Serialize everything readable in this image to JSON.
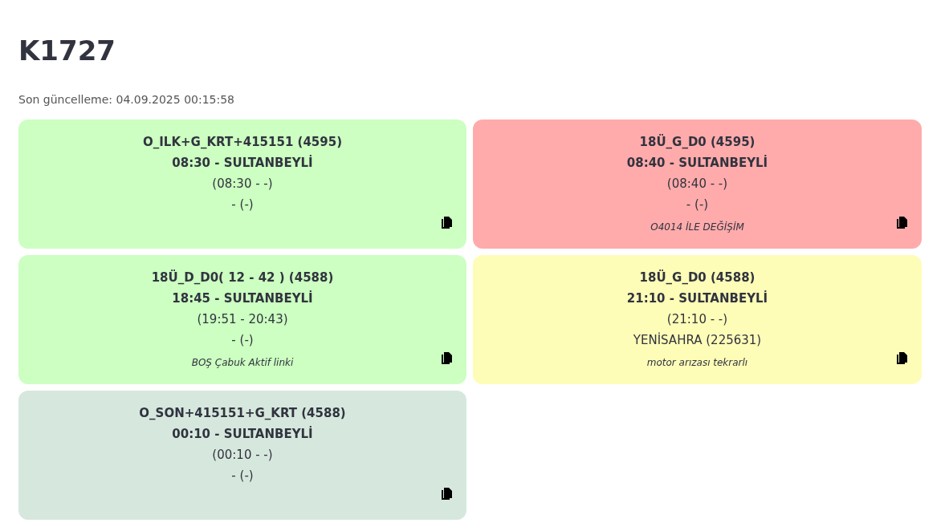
{
  "title": "K1727",
  "last_updated": "Son güncelleme: 04.09.2025 00:15:58",
  "cards": [
    {
      "color": "#ccffc1",
      "route": "O_ILK+G_KRT+415151 (4595)",
      "departure": "08:30 - SULTANBEYLİ",
      "times": "(08:30 - -)",
      "vehicle": "- (-)"
    },
    {
      "color": "#ffabab",
      "route": "18Ü_G_D0 (4595)",
      "departure": "08:40 - SULTANBEYLİ",
      "times": "(08:40 - -)",
      "vehicle": "- (-)",
      "note": "O4014 İLE DEĞİŞİM"
    },
    {
      "color": "#ccffc1",
      "route": "18Ü_D_D0( 12 - 42 ) (4588)",
      "departure": "18:45 - SULTANBEYLİ",
      "times": "(19:51 - 20:43)",
      "vehicle": "- (-)",
      "note": "BOŞ Çabuk Aktif linki"
    },
    {
      "color": "#fdfdb7",
      "route": "18Ü_G_D0 (4588)",
      "departure": "21:10 - SULTANBEYLİ",
      "times": "(21:10 - -)",
      "vehicle": "YENİSAHRA (225631)",
      "note": "motor arızası tekrarlı"
    },
    {
      "color": "#d6e8dd",
      "route": "O_SON+415151+G_KRT (4588)",
      "departure": "00:10 - SULTANBEYLİ",
      "times": "(00:10 - -)",
      "vehicle": "- (-)"
    }
  ]
}
